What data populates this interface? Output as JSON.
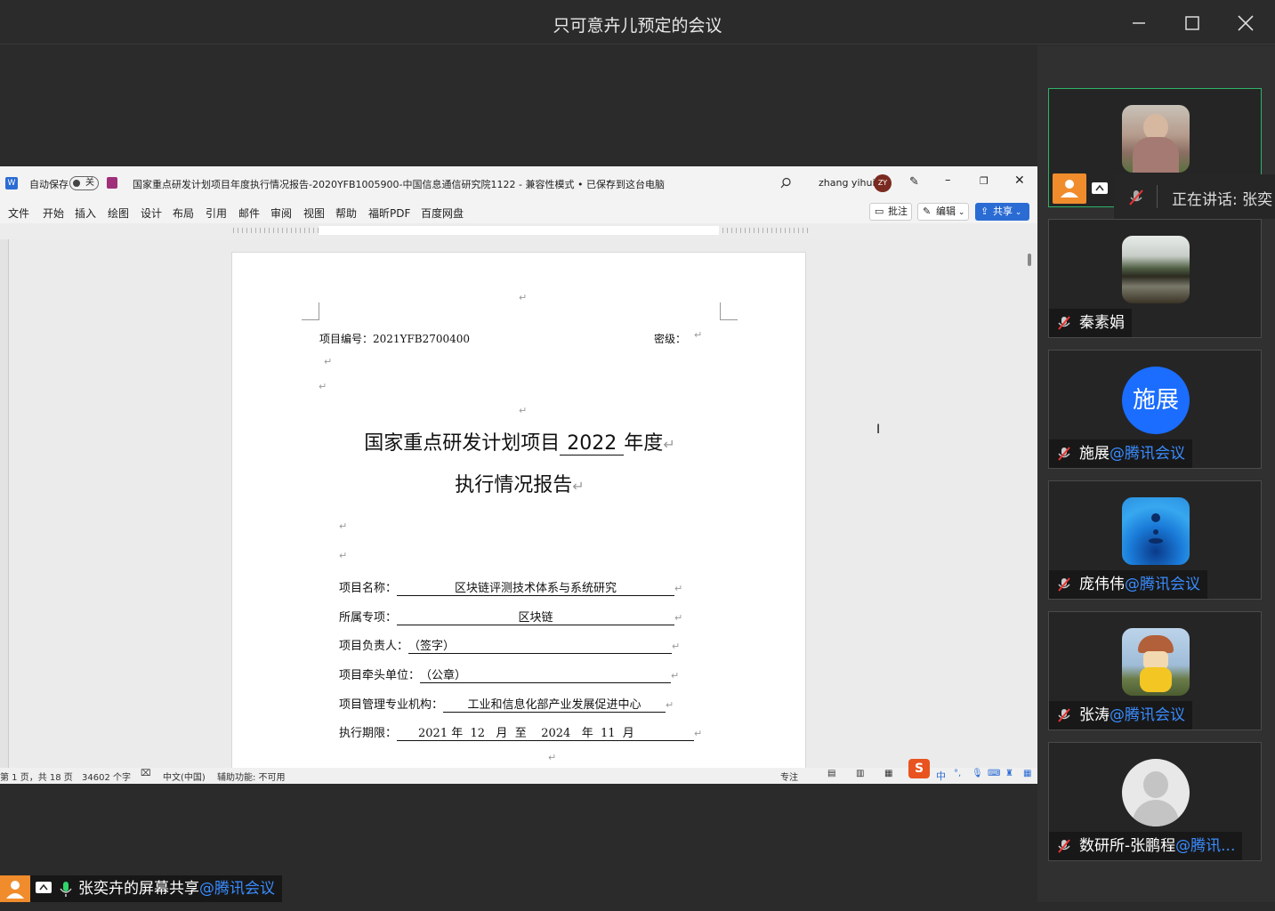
{
  "window": {
    "title": "只可意卉儿预定的会议"
  },
  "word": {
    "autosave_label": "自动保存",
    "autosave_state": "关",
    "doc_title": "国家重点研发计划项目年度执行情况报告-2020YFB1005900-中国信息通信研究院1122  -  兼容性模式 • 已保存到这台电脑",
    "user_name": "zhang yihui",
    "user_initials": "ZY",
    "menu": [
      "文件",
      "开始",
      "插入",
      "绘图",
      "设计",
      "布局",
      "引用",
      "邮件",
      "审阅",
      "视图",
      "帮助",
      "福昕PDF",
      "百度网盘"
    ],
    "comment_btn": "批注",
    "edit_btn": "编辑",
    "share_btn": "共享",
    "page": {
      "project_no_label": "项目编号：2021YFB2700400",
      "secret_label": "密级：",
      "title_line1_a": "国家重点研发计划项目",
      "title_year": "2022",
      "title_line1_b": "年度",
      "title_line2": "执行情况报告",
      "fields": [
        {
          "label": "项目名称：",
          "value": "区块链评测技术体系与系统研究"
        },
        {
          "label": "所属专项：",
          "value": "区块链"
        },
        {
          "label": "项目负责人：",
          "value": "（签字）"
        },
        {
          "label": "项目牵头单位：",
          "value": "（公章）"
        },
        {
          "label": "项目管理专业机构：",
          "value": "工业和信息化部产业发展促进中心"
        },
        {
          "label": "执行期限：",
          "value": "2021 年  12   月  至    2024   年  11  月"
        }
      ],
      "para_mark": "↵"
    },
    "status": {
      "page_info": "第 1 页，共 18 页",
      "word_count": "34602 个字",
      "language": "中文(中国)",
      "accessibility": "辅助功能: 不可用",
      "focus": "专注",
      "ime": "中"
    }
  },
  "participants": [
    {
      "name": "",
      "suffix": "",
      "speaking_text": "正在讲话: 张奕",
      "active": true,
      "avatar": "photo-woman"
    },
    {
      "name": "秦素娟",
      "suffix": "",
      "active": false,
      "avatar": "photo-lake"
    },
    {
      "name": "施展",
      "suffix": "@腾讯会议",
      "active": false,
      "avatar": "text",
      "avatar_text": "施展"
    },
    {
      "name": "庞伟伟",
      "suffix": "@腾讯会议",
      "active": false,
      "avatar": "photo-water"
    },
    {
      "name": "张涛",
      "suffix": "@腾讯会议",
      "active": false,
      "avatar": "photo-toy"
    },
    {
      "name": "数研所-张鹏程",
      "suffix": "@腾讯...",
      "active": false,
      "avatar": "default"
    }
  ],
  "share_label": {
    "name": "张奕卉的屏幕共享",
    "suffix": "@腾讯会议"
  },
  "colors": {
    "accent": "#3a8cff",
    "active_border": "#2fb26a",
    "word_blue": "#2b6cd4"
  }
}
